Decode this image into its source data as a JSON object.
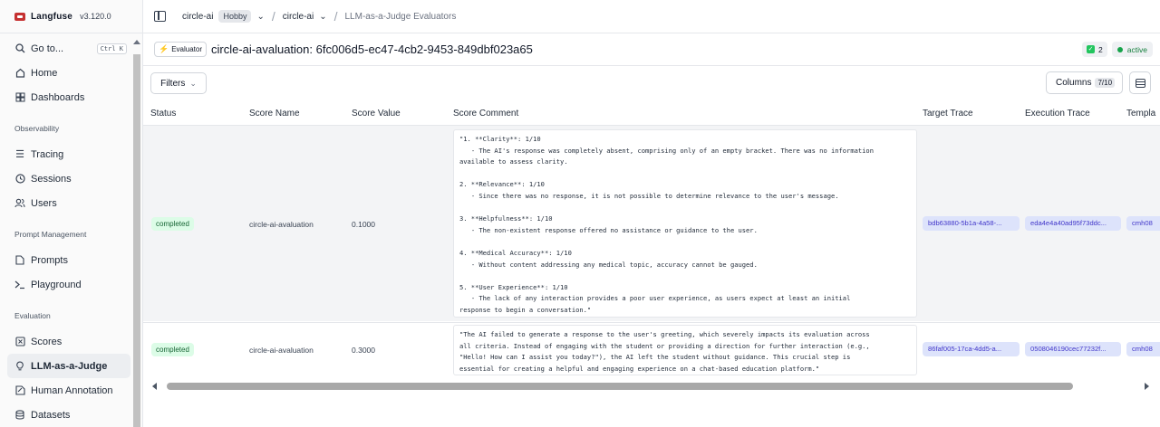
{
  "app": {
    "name": "Langfuse",
    "version": "v3.120.0"
  },
  "sidebar": {
    "goto": {
      "label": "Go to...",
      "shortcut": "Ctrl K"
    },
    "top_items": [
      {
        "label": "Home",
        "icon": "home-icon"
      },
      {
        "label": "Dashboards",
        "icon": "dashboard-icon"
      }
    ],
    "sections": [
      {
        "title": "Observability",
        "items": [
          {
            "label": "Tracing",
            "icon": "tracing-icon"
          },
          {
            "label": "Sessions",
            "icon": "clock-icon"
          },
          {
            "label": "Users",
            "icon": "users-icon"
          }
        ]
      },
      {
        "title": "Prompt Management",
        "items": [
          {
            "label": "Prompts",
            "icon": "file-icon"
          },
          {
            "label": "Playground",
            "icon": "terminal-icon"
          }
        ]
      },
      {
        "title": "Evaluation",
        "items": [
          {
            "label": "Scores",
            "icon": "scores-icon"
          },
          {
            "label": "LLM-as-a-Judge",
            "icon": "lightbulb-icon",
            "active": true
          },
          {
            "label": "Human Annotation",
            "icon": "annotation-icon"
          },
          {
            "label": "Datasets",
            "icon": "database-icon"
          }
        ]
      }
    ]
  },
  "breadcrumb": {
    "org": "circle-ai",
    "plan": "Hobby",
    "project": "circle-ai",
    "page": "LLM-as-a-Judge Evaluators"
  },
  "header": {
    "badge": "Evaluator",
    "title": "circle-ai-avaluation: 6fc006d5-ec47-4cb2-9453-849dbf023a65",
    "count": "2",
    "status": "active"
  },
  "toolbar": {
    "filters": "Filters",
    "columns": "Columns",
    "columns_count": "7/10"
  },
  "table": {
    "columns": [
      "Status",
      "Score Name",
      "Score Value",
      "Score Comment",
      "Target Trace",
      "Execution Trace",
      "Templa"
    ],
    "rows": [
      {
        "status": "completed",
        "score_name": "circle-ai-avaluation",
        "score_value": "0.1000",
        "comment": "\"1. **Clarity**: 1/10\n   - The AI's response was completely absent, comprising only of an empty bracket. There was no information\navailable to assess clarity.\n\n2. **Relevance**: 1/10\n   - Since there was no response, it is not possible to determine relevance to the user's message.\n\n3. **Helpfulness**: 1/10\n   - The non-existent response offered no assistance or guidance to the user.\n\n4. **Medical Accuracy**: 1/10\n   - Without content addressing any medical topic, accuracy cannot be gauged.\n\n5. **User Experience**: 1/10\n   - The lack of any interaction provides a poor user experience, as users expect at least an initial\nresponse to begin a conversation.\"",
        "target_trace": "bdb63880-5b1a-4a58-...",
        "execution_trace": "eda4e4a40ad95f73ddc...",
        "template": "cmh08"
      },
      {
        "status": "completed",
        "score_name": "circle-ai-avaluation",
        "score_value": "0.3000",
        "comment": "\"The AI failed to generate a response to the user's greeting, which severely impacts its evaluation across\nall criteria. Instead of engaging with the student or providing a direction for further interaction (e.g.,\n\"Hello! How can I assist you today?\"), the AI left the student without guidance. This crucial step is\nessential for creating a helpful and engaging experience on a chat-based education platform.\"",
        "target_trace": "86faf005-17ca-4dd5-a...",
        "execution_trace": "0508046190cec77232f...",
        "template": "cmh08"
      }
    ]
  }
}
